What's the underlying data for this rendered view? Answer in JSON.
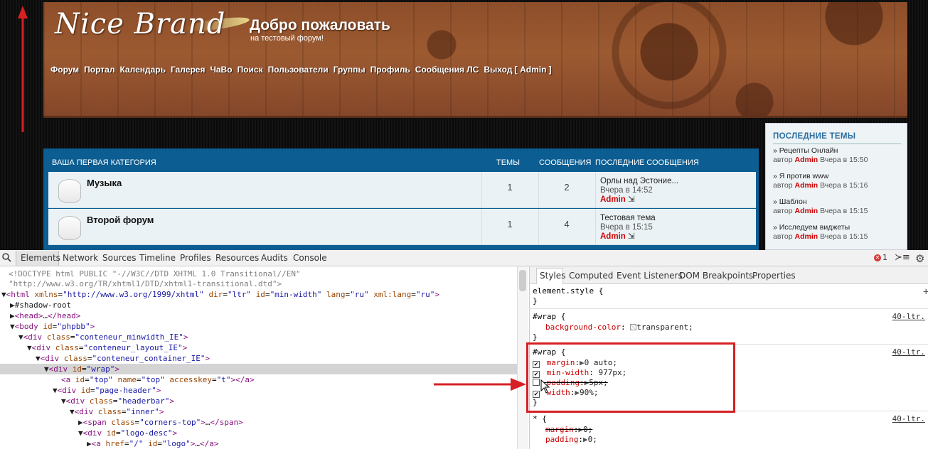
{
  "site": {
    "logo": "Nice Brand",
    "title": "Добро пожаловать",
    "description": "на тестовый форум!",
    "nav": [
      "Форум",
      "Портал",
      "Календарь",
      "Галерея",
      "ЧаВо",
      "Поиск",
      "Пользователи",
      "Группы",
      "Профиль",
      "Сообщения ЛС",
      "Выход [ Admin ]"
    ]
  },
  "forum": {
    "category": "ВАША ПЕРВАЯ КАТЕГОРИЯ",
    "col_topics": "ТЕМЫ",
    "col_posts": "СООБЩЕНИЯ",
    "col_last": "ПОСЛЕДНИЕ СООБЩЕНИЯ",
    "rows": [
      {
        "name": "Музыка",
        "topics": "1",
        "posts": "2",
        "last_title": "Орлы над Эстоние...",
        "last_date": "Вчера в 14:52",
        "last_author": "Admin"
      },
      {
        "name": "Второй форум",
        "topics": "1",
        "posts": "4",
        "last_title": "Тестовая тема",
        "last_date": "Вчера в 15:15",
        "last_author": "Admin"
      }
    ]
  },
  "sidebar": {
    "title": "ПОСЛЕДНИЕ ТЕМЫ",
    "items": [
      {
        "title": "» Рецепты Онлайн",
        "by": "автор",
        "author": "Admin",
        "date": "Вчера в 15:50"
      },
      {
        "title": "» Я против www",
        "by": "автор",
        "author": "Admin",
        "date": "Вчера в 15:16"
      },
      {
        "title": "» Шаблон",
        "by": "автор",
        "author": "Admin",
        "date": "Вчера в 15:15"
      },
      {
        "title": "» Исследуем виджеты",
        "by": "автор",
        "author": "Admin",
        "date": "Вчера в 15:15"
      }
    ]
  },
  "devtools": {
    "tabs": [
      "Elements",
      "Network",
      "Sources",
      "Timeline",
      "Profiles",
      "Resources",
      "Audits",
      "Console"
    ],
    "error_count": "1",
    "styles_tabs": [
      "Styles",
      "Computed",
      "Event Listeners",
      "DOM Breakpoints",
      "Properties"
    ],
    "element_style": "element.style {",
    "close_brace": "}",
    "rule1_selector": "#wrap {",
    "rule1_source": "40-ltr.",
    "rule1_prop": "background-color",
    "rule1_val": "transparent;",
    "rule2_selector": "#wrap {",
    "rule2_source": "40-ltr.",
    "rule2_props": [
      {
        "name": "margin",
        "value": "0 auto;",
        "checked": true,
        "arrow": true,
        "struck": false
      },
      {
        "name": "min-width",
        "value": "977px;",
        "checked": true,
        "arrow": false,
        "struck": false
      },
      {
        "name": "padding",
        "value": "5px;",
        "checked": false,
        "arrow": true,
        "struck": true
      },
      {
        "name": "width",
        "value": "90%;",
        "checked": true,
        "arrow": true,
        "struck": false
      }
    ],
    "rule3_selector": "* {",
    "rule3_source": "40-ltr.",
    "rule3_props": [
      {
        "name": "margin",
        "value": "0;",
        "struck": true
      },
      {
        "name": "padding",
        "value": "0;",
        "struck": false
      }
    ]
  },
  "colors": {
    "accent_red": "#d62024",
    "forum_blue": "#0c5d91",
    "author_red": "#cc0000"
  }
}
